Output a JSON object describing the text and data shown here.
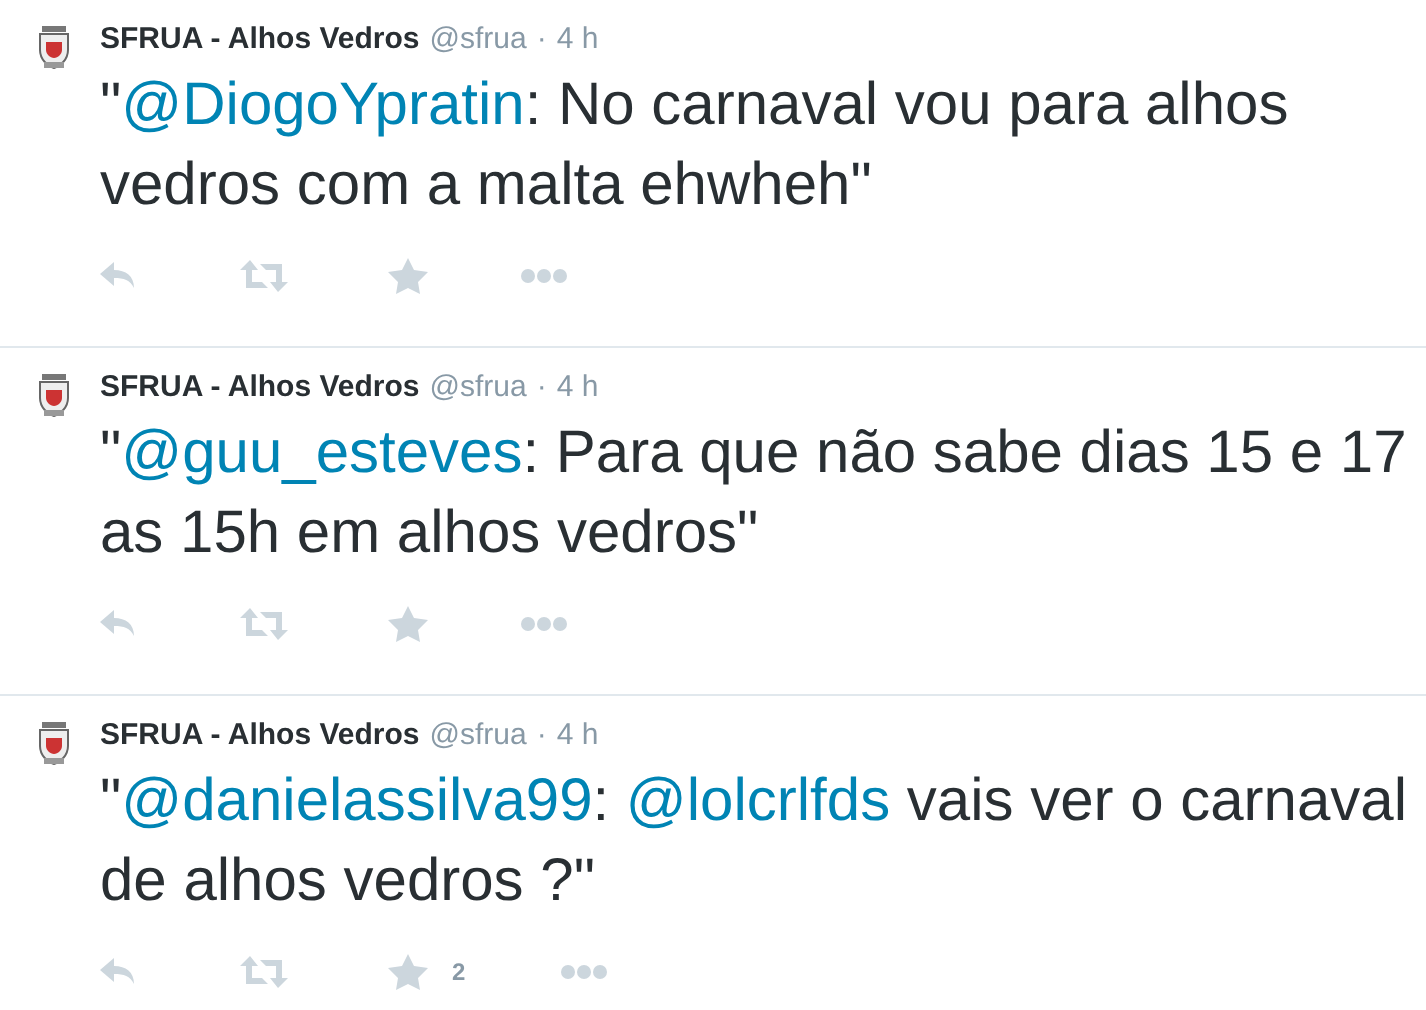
{
  "tweets": [
    {
      "name": "SFRUA - Alhos Vedros",
      "handle": "@sfrua",
      "separator": "·",
      "time": "4 h",
      "text": [
        {
          "kind": "text",
          "text": "\""
        },
        {
          "kind": "mention",
          "text": "@DiogoYpratin"
        },
        {
          "kind": "text",
          "text": ": No carnaval vou para alhos vedros com a malta ehwheh\""
        }
      ]
    },
    {
      "name": "SFRUA - Alhos Vedros",
      "handle": "@sfrua",
      "separator": "·",
      "time": "4 h",
      "text": [
        {
          "kind": "text",
          "text": "\""
        },
        {
          "kind": "mention",
          "text": "@guu_esteves"
        },
        {
          "kind": "text",
          "text": ": Para que não sabe dias 15 e 17 as 15h em alhos vedros\""
        }
      ]
    },
    {
      "name": "SFRUA - Alhos Vedros",
      "handle": "@sfrua",
      "separator": "·",
      "time": "4 h",
      "text": [
        {
          "kind": "text",
          "text": "\""
        },
        {
          "kind": "mention",
          "text": "@danielassilva99"
        },
        {
          "kind": "text",
          "text": ": "
        },
        {
          "kind": "mention",
          "text": "@lolcrlfds"
        },
        {
          "kind": "text",
          "text": " vais ver o carnaval de alhos vedros ?\""
        }
      ],
      "favorite_count": "2"
    }
  ]
}
